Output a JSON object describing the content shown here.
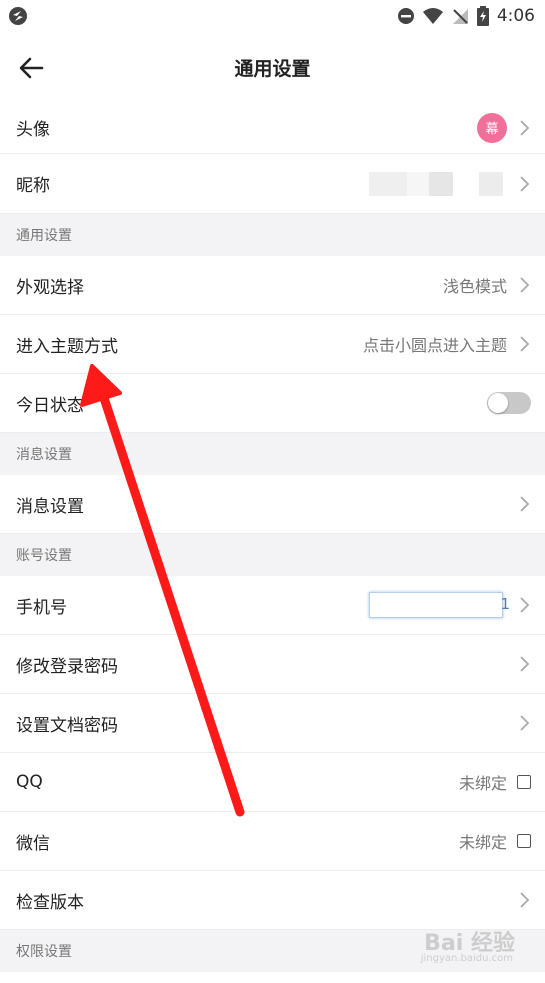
{
  "status_bar": {
    "time": "4:06"
  },
  "header": {
    "title": "通用设置"
  },
  "profile": {
    "avatar_label": "头像",
    "avatar_text": "幕",
    "nickname_label": "昵称"
  },
  "general": {
    "section_title": "通用设置",
    "appearance_label": "外观选择",
    "appearance_value": "浅色模式",
    "enter_theme_label": "进入主题方式",
    "enter_theme_value": "点击小圆点进入主题",
    "today_status_label": "今日状态"
  },
  "message": {
    "section_title": "消息设置",
    "message_label": "消息设置"
  },
  "account": {
    "section_title": "账号设置",
    "phone_label": "手机号",
    "phone_digit": "1",
    "change_password_label": "修改登录密码",
    "doc_password_label": "设置文档密码",
    "qq_label": "QQ",
    "qq_value": "未绑定",
    "wechat_label": "微信",
    "wechat_value": "未绑定",
    "check_version_label": "检查版本"
  },
  "permission": {
    "section_title": "权限设置"
  },
  "watermark": {
    "text": "Bai 经验",
    "sub": "jingyan.baidu.com"
  },
  "colors": {
    "annotation_arrow": "#ff1a1a",
    "avatar_bg": "#f26f9a",
    "section_bg": "#f3f3f5"
  }
}
